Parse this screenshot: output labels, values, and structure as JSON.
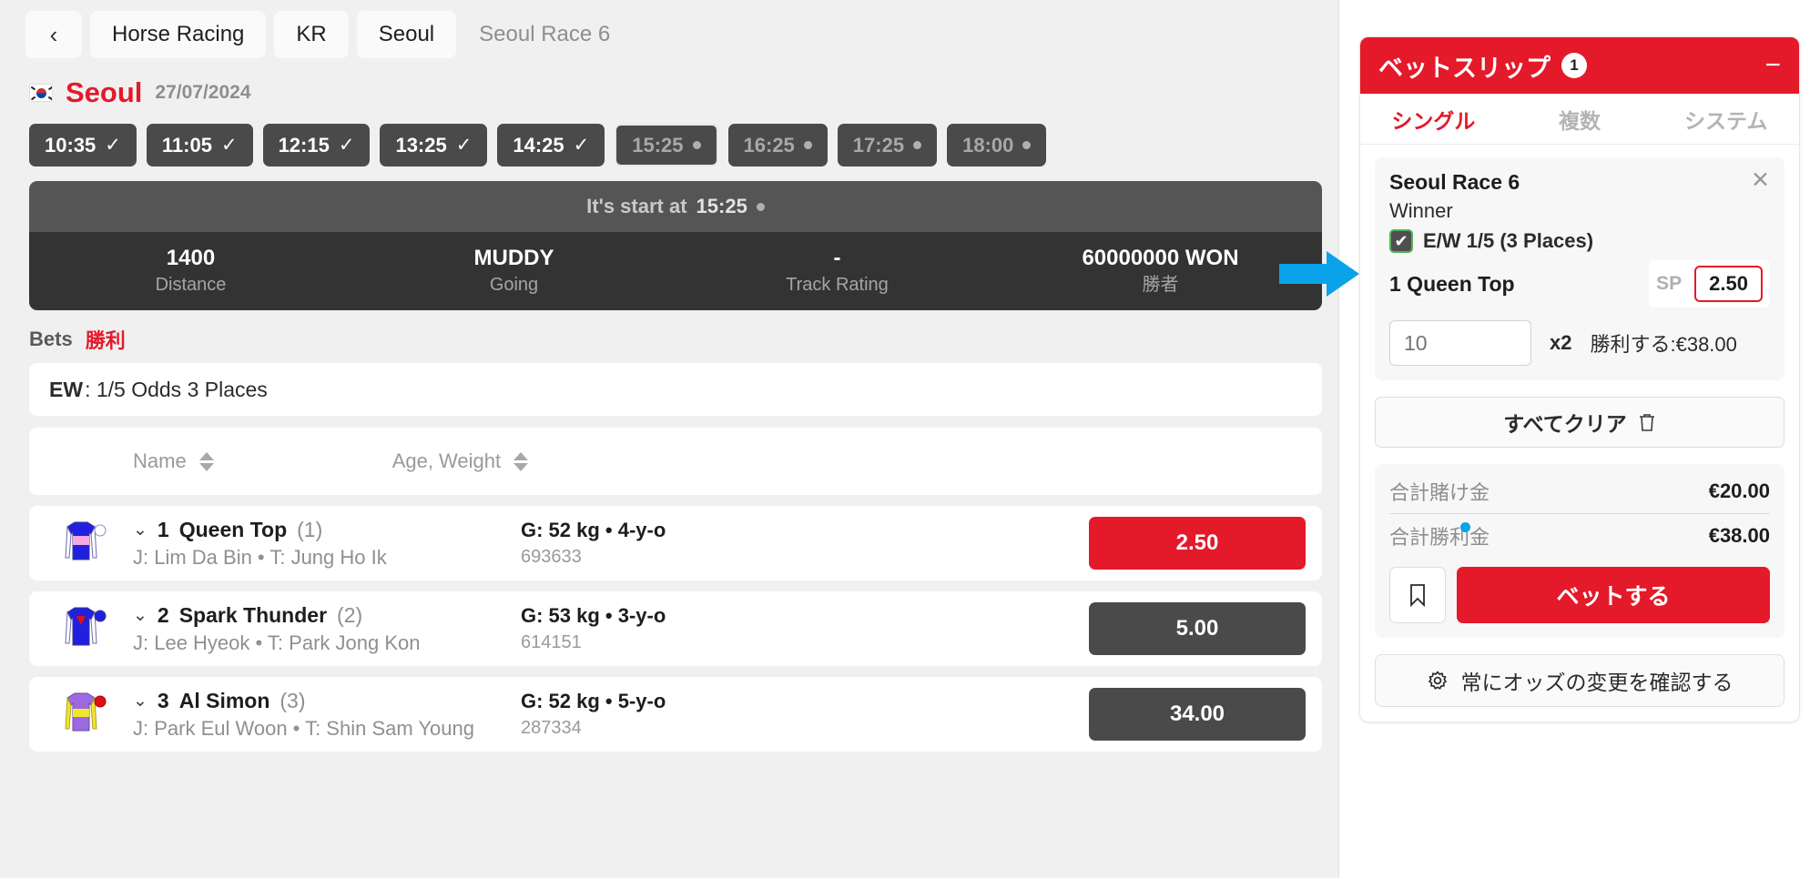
{
  "breadcrumb": {
    "back_icon": "chevron-left-icon",
    "items": [
      {
        "label": "Horse Racing",
        "muted": false
      },
      {
        "label": "KR",
        "muted": false
      },
      {
        "label": "Seoul",
        "muted": false
      },
      {
        "label": "Seoul Race 6",
        "muted": true
      }
    ]
  },
  "venue": {
    "flag_icon": "kr-flag-icon",
    "name": "Seoul",
    "date": "27/07/2024",
    "accent_color": "#e4192a"
  },
  "race_times": [
    {
      "time": "10:35",
      "state": "past",
      "marker": "check"
    },
    {
      "time": "11:05",
      "state": "past",
      "marker": "check"
    },
    {
      "time": "12:15",
      "state": "past",
      "marker": "check"
    },
    {
      "time": "13:25",
      "state": "past",
      "marker": "check"
    },
    {
      "time": "14:25",
      "state": "past",
      "marker": "check"
    },
    {
      "time": "15:25",
      "state": "upcoming",
      "marker": "dot",
      "selected": true
    },
    {
      "time": "16:25",
      "state": "upcoming",
      "marker": "dot"
    },
    {
      "time": "17:25",
      "state": "upcoming",
      "marker": "dot"
    },
    {
      "time": "18:00",
      "state": "upcoming",
      "marker": "dot"
    }
  ],
  "race_banner": {
    "start_prefix": "It's start at",
    "start_time": "15:25",
    "stats": [
      {
        "value": "1400",
        "label": "Distance"
      },
      {
        "value": "MUDDY",
        "label": "Going"
      },
      {
        "value": "-",
        "label": "Track Rating"
      },
      {
        "value": "60000000 WON",
        "label": "勝者"
      }
    ]
  },
  "bets_section": {
    "label": "Bets",
    "market": "勝利",
    "ew_prefix": "EW",
    "ew_text": ": 1/5 Odds 3 Places"
  },
  "table": {
    "columns": [
      {
        "label": "Name",
        "sortable": true
      },
      {
        "label": "Age, Weight",
        "sortable": true
      }
    ]
  },
  "runners": [
    {
      "number": "1",
      "name": "Queen Top",
      "draw": "(1)",
      "jockey_trainer": "J: Lim Da Bin • T: Jung Ho Ik",
      "weight_age": "G: 52 kg • 4-y-o",
      "form": "693633",
      "odds": "2.50",
      "selected": true,
      "silk": {
        "body": "#2020e0",
        "band": "#f7a8e0",
        "cap": "#ffffff",
        "sleeve": "#ffffff"
      }
    },
    {
      "number": "2",
      "name": "Spark Thunder",
      "draw": "(2)",
      "jockey_trainer": "J: Lee Hyeok • T: Park Jong Kon",
      "weight_age": "G: 53 kg • 3-y-o",
      "form": "614151",
      "odds": "5.00",
      "selected": false,
      "silk": {
        "body": "#2020e0",
        "band": "#e01010",
        "cap": "#2020e0",
        "sleeve": "#ffffff"
      }
    },
    {
      "number": "3",
      "name": "Al Simon",
      "draw": "(3)",
      "jockey_trainer": "J: Park Eul Woon • T: Shin Sam Young",
      "weight_age": "G: 52 kg • 5-y-o",
      "form": "287334",
      "odds": "34.00",
      "selected": false,
      "silk": {
        "body": "#9b6ae0",
        "band": "#f2e530",
        "cap": "#e01010",
        "sleeve": "#f2e530"
      }
    }
  ],
  "betslip": {
    "title": "ベットスリップ",
    "count": "1",
    "minimize_icon": "minimize-icon",
    "tabs": [
      {
        "label": "シングル",
        "active": true
      },
      {
        "label": "複数",
        "active": false
      },
      {
        "label": "システム",
        "active": false
      }
    ],
    "selection": {
      "race": "Seoul Race 6",
      "remove_icon": "close-icon",
      "market": "Winner",
      "ew_label": "E/W 1/5 (3 Places)",
      "ew_checked": true,
      "pick": "1 Queen Top",
      "sp_label": "SP",
      "odds": "2.50",
      "stake_value": "10",
      "multiplier": "x2",
      "to_win": "勝利する:€38.00"
    },
    "clear_all": "すべてクリア",
    "clear_icon": "trash-icon",
    "totals": [
      {
        "label": "合計賭け金",
        "value": "€20.00"
      },
      {
        "label": "合計勝利金",
        "value": "€38.00"
      }
    ],
    "bookmark_icon": "bookmark-icon",
    "place_bet": "ベットする",
    "confirm_icon": "gear-icon",
    "confirm_label": "常にオッズの変更を確認する"
  }
}
